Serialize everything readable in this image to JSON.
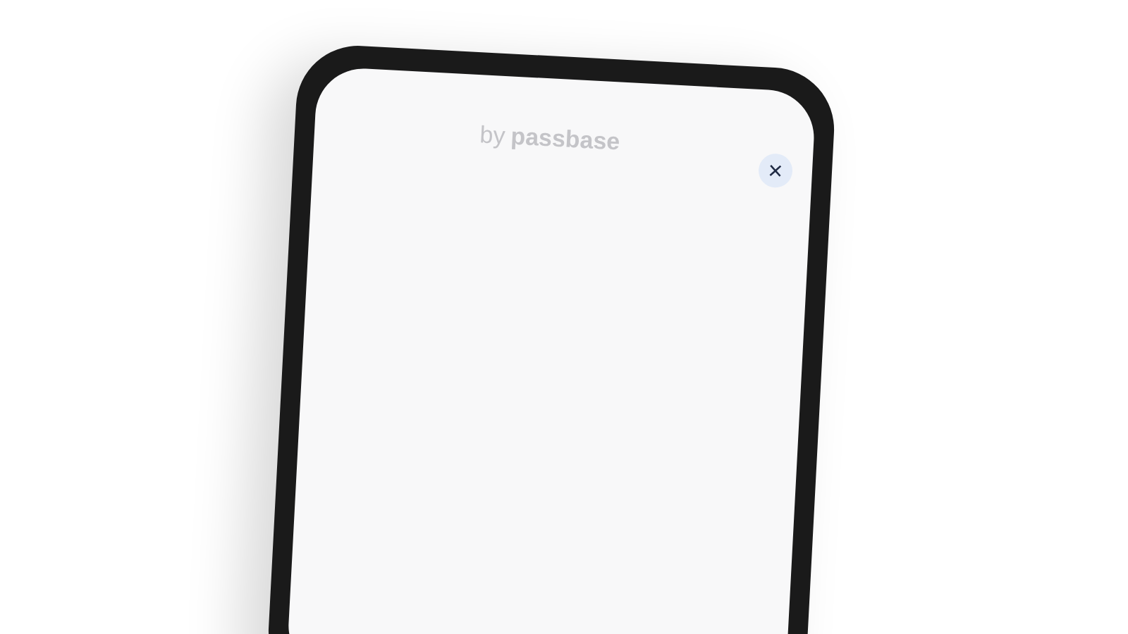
{
  "header": {
    "by": "by",
    "brand": "passbase"
  },
  "close_button": {
    "label": "×"
  }
}
